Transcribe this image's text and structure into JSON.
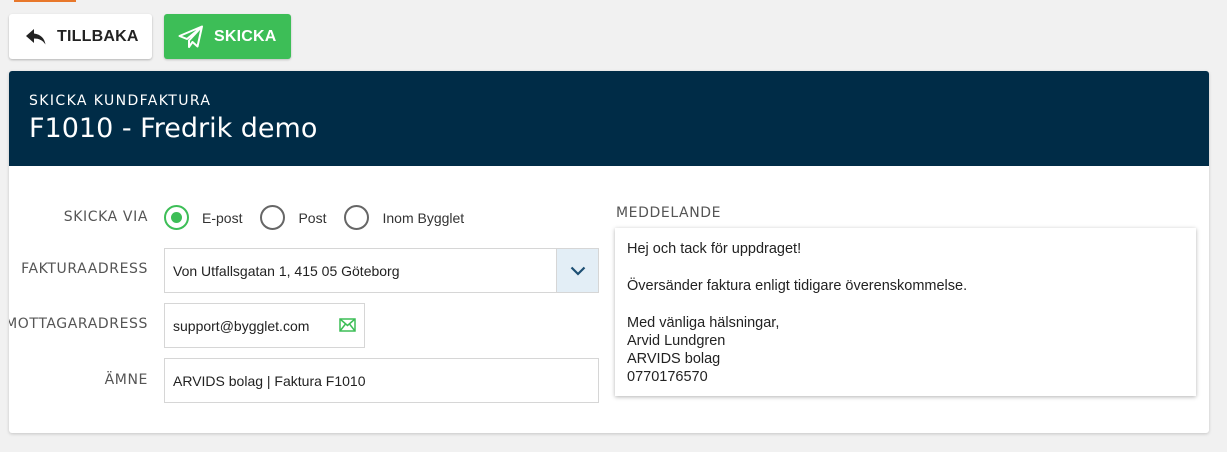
{
  "toolbar": {
    "back_label": "TILLBAKA",
    "send_label": "SKICKA"
  },
  "header": {
    "subtitle": "SKICKA KUNDFAKTURA",
    "title": "F1010 - Fredrik demo"
  },
  "form": {
    "send_via_label": "SKICKA VIA",
    "send_via_options": [
      {
        "label": "E-post",
        "selected": true
      },
      {
        "label": "Post",
        "selected": false
      },
      {
        "label": "Inom Bygglet",
        "selected": false
      }
    ],
    "invoice_address_label": "FAKTURAADRESS",
    "invoice_address_value": "Von Utfallsgatan 1, 415 05 Göteborg",
    "recipient_label": "MOTTAGARADRESS",
    "recipient_value": "support@bygglet.com",
    "subject_label": "ÄMNE",
    "subject_value": "ARVIDS bolag | Faktura F1010"
  },
  "message": {
    "label": "MEDDELANDE",
    "greeting": "Hej och tack för uppdraget!",
    "body": "Översänder faktura enligt tidigare överenskommelse.",
    "closing": "Med vänliga hälsningar,",
    "name": "Arvid Lundgren",
    "company": "ARVIDS bolag",
    "phone": "0770176570"
  },
  "colors": {
    "accent_green": "#3dbe57",
    "header_navy": "#002c47",
    "dropdown_bg": "#e3eef6"
  },
  "icons": {
    "back": "reply-arrow-icon",
    "send": "paper-plane-icon",
    "dropdown": "chevron-down-icon",
    "mail": "envelope-icon"
  }
}
